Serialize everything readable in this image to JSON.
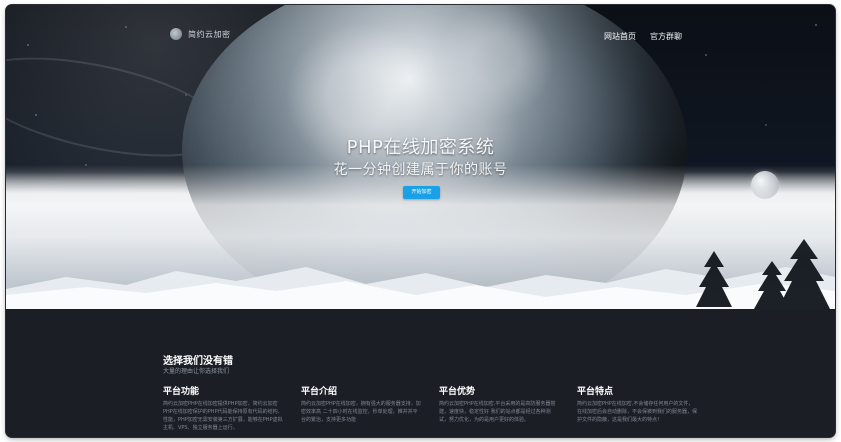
{
  "header": {
    "logo_text": "简约云加密",
    "nav": [
      {
        "label": "网站首页"
      },
      {
        "label": "官方群聊"
      }
    ]
  },
  "hero": {
    "title": "PHP在线加密系统",
    "subtitle": "花一分钟创建属于你的账号",
    "button_label": "开始加密"
  },
  "section": {
    "title": "选择我们没有错",
    "subtitle": "大量的理由让你选择我们",
    "features": [
      {
        "title": "平台功能",
        "text": "简约云加密PHP在线加密提供PHP加密，简约云加密PHP在线加密保护的PHP代码能保持原有代码的结构、性能，PHP加密无需安装第三方扩展，能够在PHP虚拟主机、VPS、独立服务器上运行。"
      },
      {
        "title": "平台介绍",
        "text": "简约云加密PHP在线加密，拥有强大的服务器支持，加密效率高 二十四小时在线监控，秒单处理，推并并平台的繁治，支持更多功能"
      },
      {
        "title": "平台优势",
        "text": "简约云加密PHP在线加密,平台采用的是高防服务器搭建，速度快，稳定性好 我们的站点都是经过各种测试，努力优化，为的是用户更好的体验。"
      },
      {
        "title": "平台特点",
        "text": "简约云加密PHP在线加密,不会储存任何用户的文件，在线加密后会自动删除，不会保被到我们的服务器，保护文件的隐蔽，这是我们最大的特点！"
      }
    ]
  },
  "colors": {
    "lower_bg": "#1c1e26",
    "accent": "#1aa0e6"
  }
}
